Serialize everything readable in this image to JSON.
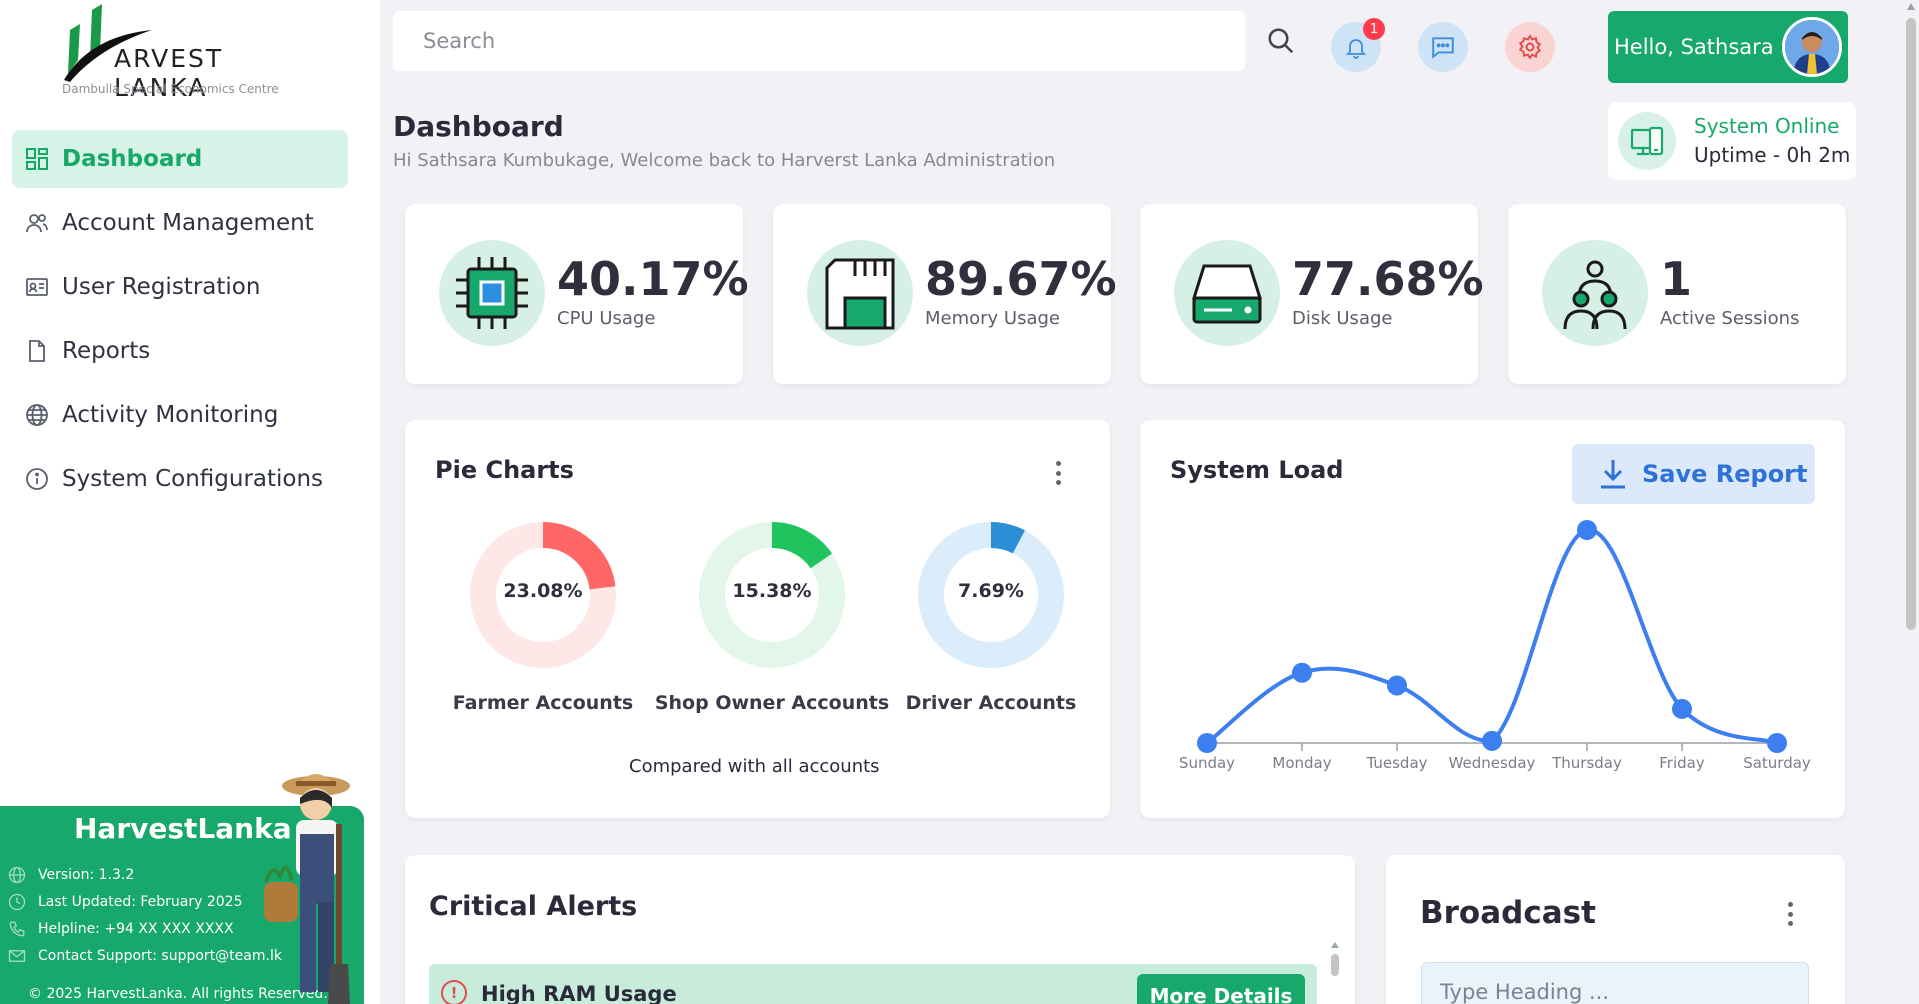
{
  "brand": {
    "logo_text": "ARVEST LANKA",
    "subtitle": "Dambulla Special Economics Centre"
  },
  "nav": {
    "items": [
      {
        "label": "Dashboard",
        "icon": "grid-icon",
        "active": true
      },
      {
        "label": "Account Management",
        "icon": "users-icon"
      },
      {
        "label": "User Registration",
        "icon": "id-card-icon"
      },
      {
        "label": "Reports",
        "icon": "document-icon"
      },
      {
        "label": "Activity Monitoring",
        "icon": "globe-icon"
      },
      {
        "label": "System Configurations",
        "icon": "info-icon"
      }
    ]
  },
  "promo": {
    "title": "HarvestLanka",
    "version": "Version: 1.3.2",
    "updated": "Last Updated: February 2025",
    "helpline": "Helpline: +94 XX XXX XXXX",
    "contact": "Contact Support: support@team.lk",
    "copyright": "© 2025 HarvestLanka. All rights Reserved."
  },
  "topbar": {
    "search_placeholder": "Search",
    "notification_count": "1",
    "greeting": "Hello, Sathsara"
  },
  "header": {
    "title": "Dashboard",
    "subtitle": "Hi Sathsara Kumbukage, Welcome back to Harverst Lanka Administration",
    "system_status": "System Online",
    "uptime": "Uptime - 0h 2m"
  },
  "stats": [
    {
      "value": "40.17%",
      "label": "CPU Usage",
      "icon": "cpu-icon"
    },
    {
      "value": "89.67%",
      "label": "Memory Usage",
      "icon": "memory-card-icon"
    },
    {
      "value": "77.68%",
      "label": "Disk Usage",
      "icon": "hard-drive-icon"
    },
    {
      "value": "1",
      "label": "Active Sessions",
      "icon": "network-users-icon"
    }
  ],
  "pie_panel": {
    "title": "Pie Charts",
    "caption": "Compared with all accounts",
    "charts": [
      {
        "label": "23.08%",
        "name": "Farmer Accounts",
        "percent": 23.08,
        "color": "#ff6767",
        "track": "#fde7e7"
      },
      {
        "label": "15.38%",
        "name": "Shop Owner Accounts",
        "percent": 15.38,
        "color": "#20c45e",
        "track": "#e2f6ea"
      },
      {
        "label": "7.69%",
        "name": "Driver Accounts",
        "percent": 7.69,
        "color": "#2b8fd8",
        "track": "#dbecfa"
      }
    ]
  },
  "load_panel": {
    "title": "System Load",
    "save_label": "Save Report"
  },
  "chart_data": {
    "type": "line",
    "title": "System Load",
    "categories": [
      "Sunday",
      "Monday",
      "Tuesday",
      "Wednesday",
      "Thursday",
      "Friday",
      "Saturday"
    ],
    "series": [
      {
        "values": [
          0,
          33,
          27,
          1,
          100,
          16,
          0
        ]
      }
    ],
    "ylim": [
      0,
      100
    ],
    "color": "#3b7ff0",
    "grid": false
  },
  "alerts": {
    "title": "Critical Alerts",
    "items": [
      {
        "title": "High RAM Usage",
        "button": "More Details"
      }
    ]
  },
  "broadcast": {
    "title": "Broadcast",
    "heading_placeholder": "Type Heading ..."
  }
}
